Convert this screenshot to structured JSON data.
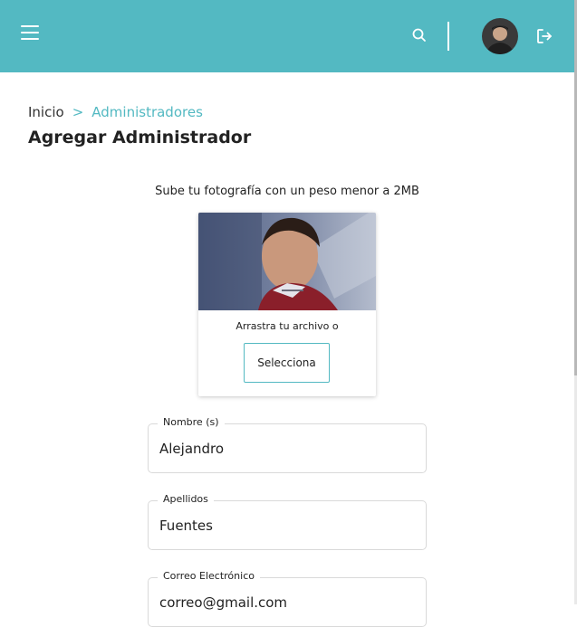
{
  "header": {
    "menu_icon": "hamburger-menu-icon",
    "search_icon": "search-icon",
    "avatar_icon": "user-avatar",
    "logout_icon": "logout-icon",
    "bg_color": "#53b9c2"
  },
  "breadcrumb": {
    "home": "Inicio",
    "separator": ">",
    "current": "Administradores"
  },
  "page": {
    "title": "Agregar Administrador"
  },
  "upload": {
    "hint": "Sube tu fotografía con un peso menor a 2MB",
    "drag_text": "Arrastra tu archivo o",
    "select_label": "Selecciona"
  },
  "form": {
    "nombre_label": "Nombre (s)",
    "nombre_value": "Alejandro",
    "apellidos_label": "Apellidos",
    "apellidos_value": "Fuentes",
    "correo_label": "Correo Electrónico",
    "correo_value": "correo@gmail.com"
  },
  "accent_color": "#53b9c2"
}
